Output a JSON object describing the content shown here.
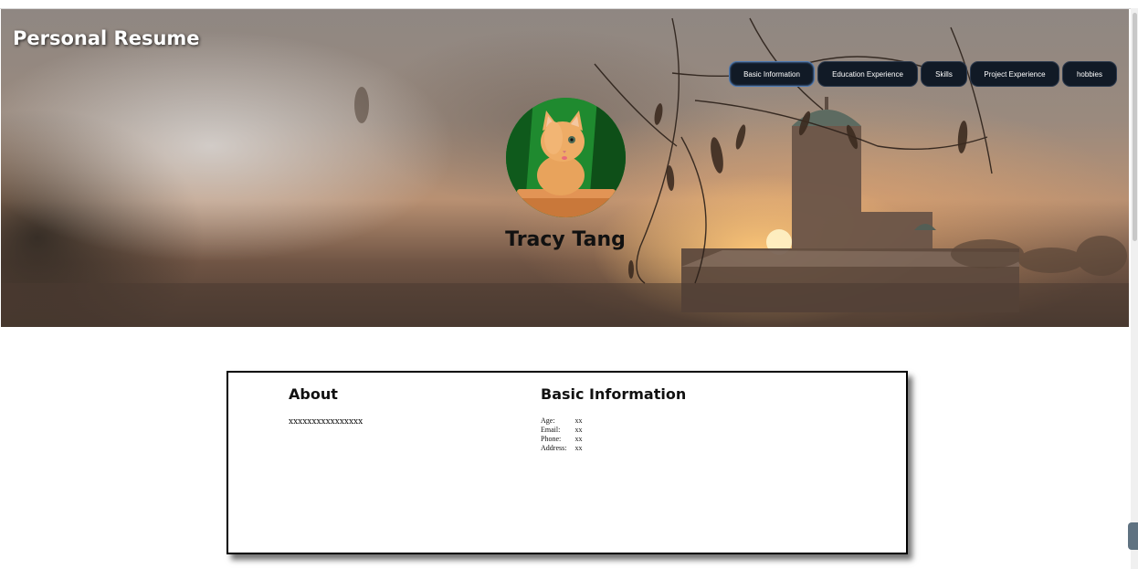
{
  "header": {
    "title": "Personal Resume",
    "nav": [
      {
        "label": "Basic Information"
      },
      {
        "label": "Education Experience"
      },
      {
        "label": "Skills"
      },
      {
        "label": "Project Experience"
      },
      {
        "label": "hobbies"
      }
    ]
  },
  "profile": {
    "name": "Tracy Tang",
    "avatar_icon": "cat-photo"
  },
  "about": {
    "title": "About",
    "text": "xxxxxxxxxxxxxxxx"
  },
  "basic_info": {
    "title": "Basic Information",
    "rows": [
      {
        "label": "Age:",
        "value": "xx"
      },
      {
        "label": "Email:",
        "value": "xx"
      },
      {
        "label": "Phone:",
        "value": "xx"
      },
      {
        "label": "Address:",
        "value": "xx"
      }
    ]
  },
  "colors": {
    "nav_bg": "#111a26",
    "card_border": "#000000"
  }
}
